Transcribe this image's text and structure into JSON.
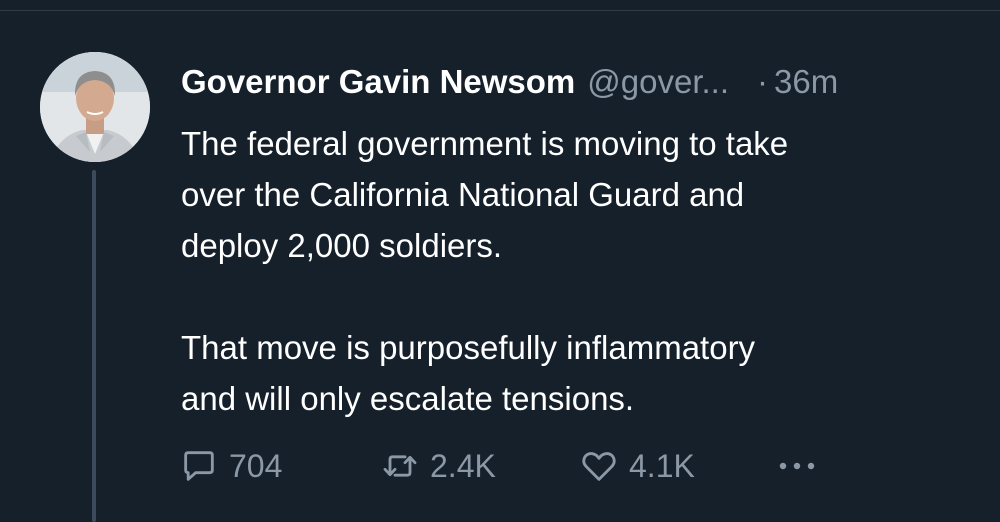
{
  "tweet": {
    "author_name": "Governor Gavin Newsom",
    "handle": "@gover...",
    "separator": "·",
    "timestamp": "36m",
    "text": "The federal government is moving to take\nover the California National Guard and\ndeploy 2,000 soldiers.\n\nThat move is purposefully inflammatory\nand will only escalate tensions."
  },
  "actions": {
    "reply_count": "704",
    "retweet_count": "2.4K",
    "like_count": "4.1K"
  },
  "icons": {
    "reply": "speech-bubble-icon",
    "retweet": "retweet-arrows-icon",
    "like": "heart-icon",
    "more": "more-dots-icon"
  },
  "colors": {
    "background": "#15202b",
    "text_primary": "#ffffff",
    "text_secondary": "#8b98a5",
    "thread_line": "#3b4b5c"
  }
}
